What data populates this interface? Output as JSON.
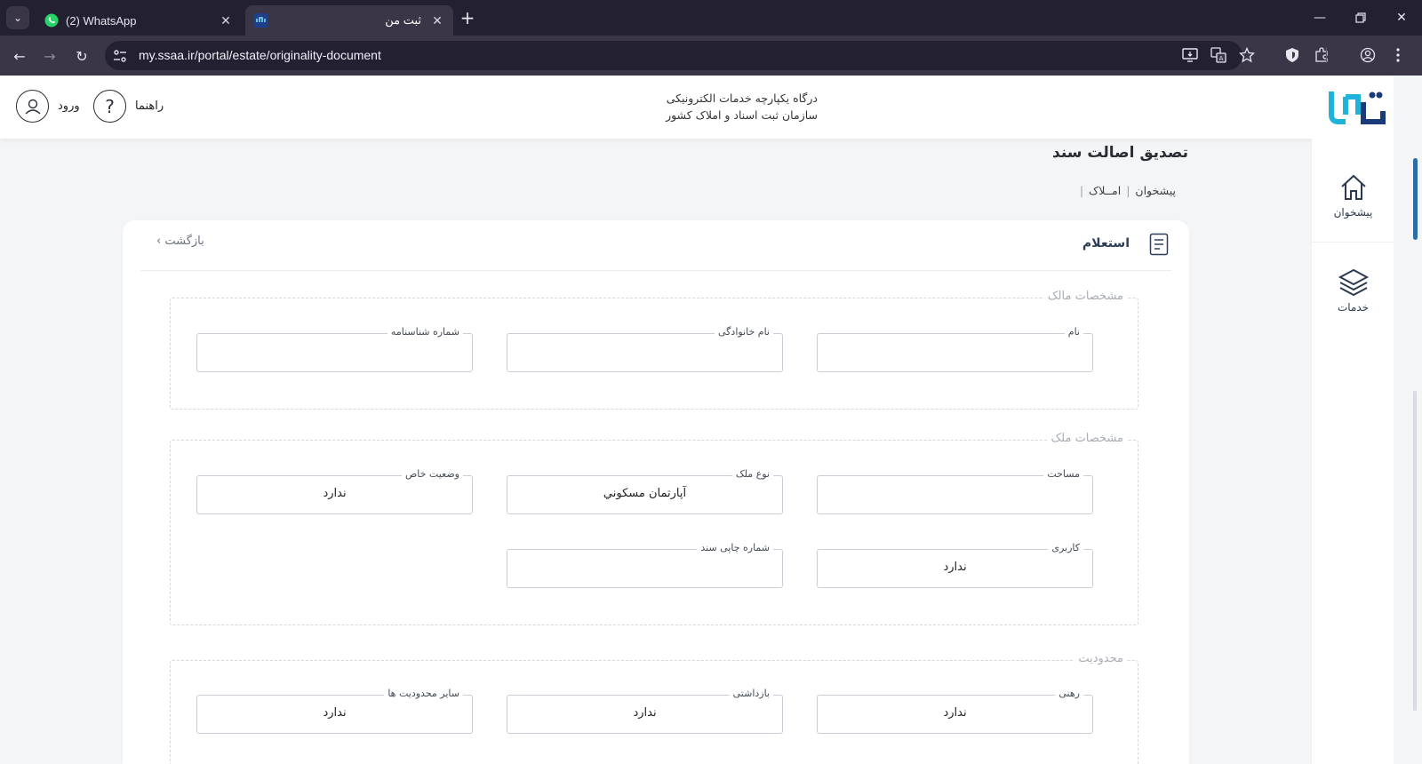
{
  "browser": {
    "tabs": [
      {
        "title": "(2) WhatsApp",
        "active": false
      },
      {
        "title": "ثبت من",
        "active": true
      }
    ],
    "url": "my.ssaa.ir/portal/estate/originality-document"
  },
  "header": {
    "title_line1": "درگاه یکپارچه خدمات الکترونیکی",
    "title_line2": "سازمان ثبت اسناد و املاک کشور",
    "help_label": "راهنما",
    "login_label": "ورود"
  },
  "sidebar": {
    "items": [
      {
        "label": "پیشخوان",
        "icon": "home-icon"
      },
      {
        "label": "خدمات",
        "icon": "layers-icon"
      }
    ]
  },
  "page": {
    "title": "تصدیق اصالت سند",
    "breadcrumb": [
      "پیشخوان",
      "امــلاک"
    ]
  },
  "card": {
    "title": "استعلام",
    "back_label": "بازگشت"
  },
  "sections": {
    "owner": {
      "legend": "مشخصات مالک",
      "fields": [
        {
          "label": "نام",
          "value": ""
        },
        {
          "label": "نام خانوادگی",
          "value": ""
        },
        {
          "label": "شماره شناسنامه",
          "value": ""
        }
      ]
    },
    "property": {
      "legend": "مشخصات ملک",
      "fields": [
        {
          "label": "مساحت",
          "value": ""
        },
        {
          "label": "نوع ملک",
          "value": "آپارتمان مسكوني"
        },
        {
          "label": "وضعیت خاص",
          "value": "ندارد"
        },
        {
          "label": "کاربری",
          "value": "ندارد"
        },
        {
          "label": "شماره چاپی سند",
          "value": ""
        }
      ]
    },
    "restriction": {
      "legend": "محدودیت",
      "fields": [
        {
          "label": "رهنی",
          "value": "ندارد"
        },
        {
          "label": "بازداشتی",
          "value": "ندارد"
        },
        {
          "label": "سایر محدودیت ها",
          "value": "ندارد"
        }
      ]
    }
  }
}
